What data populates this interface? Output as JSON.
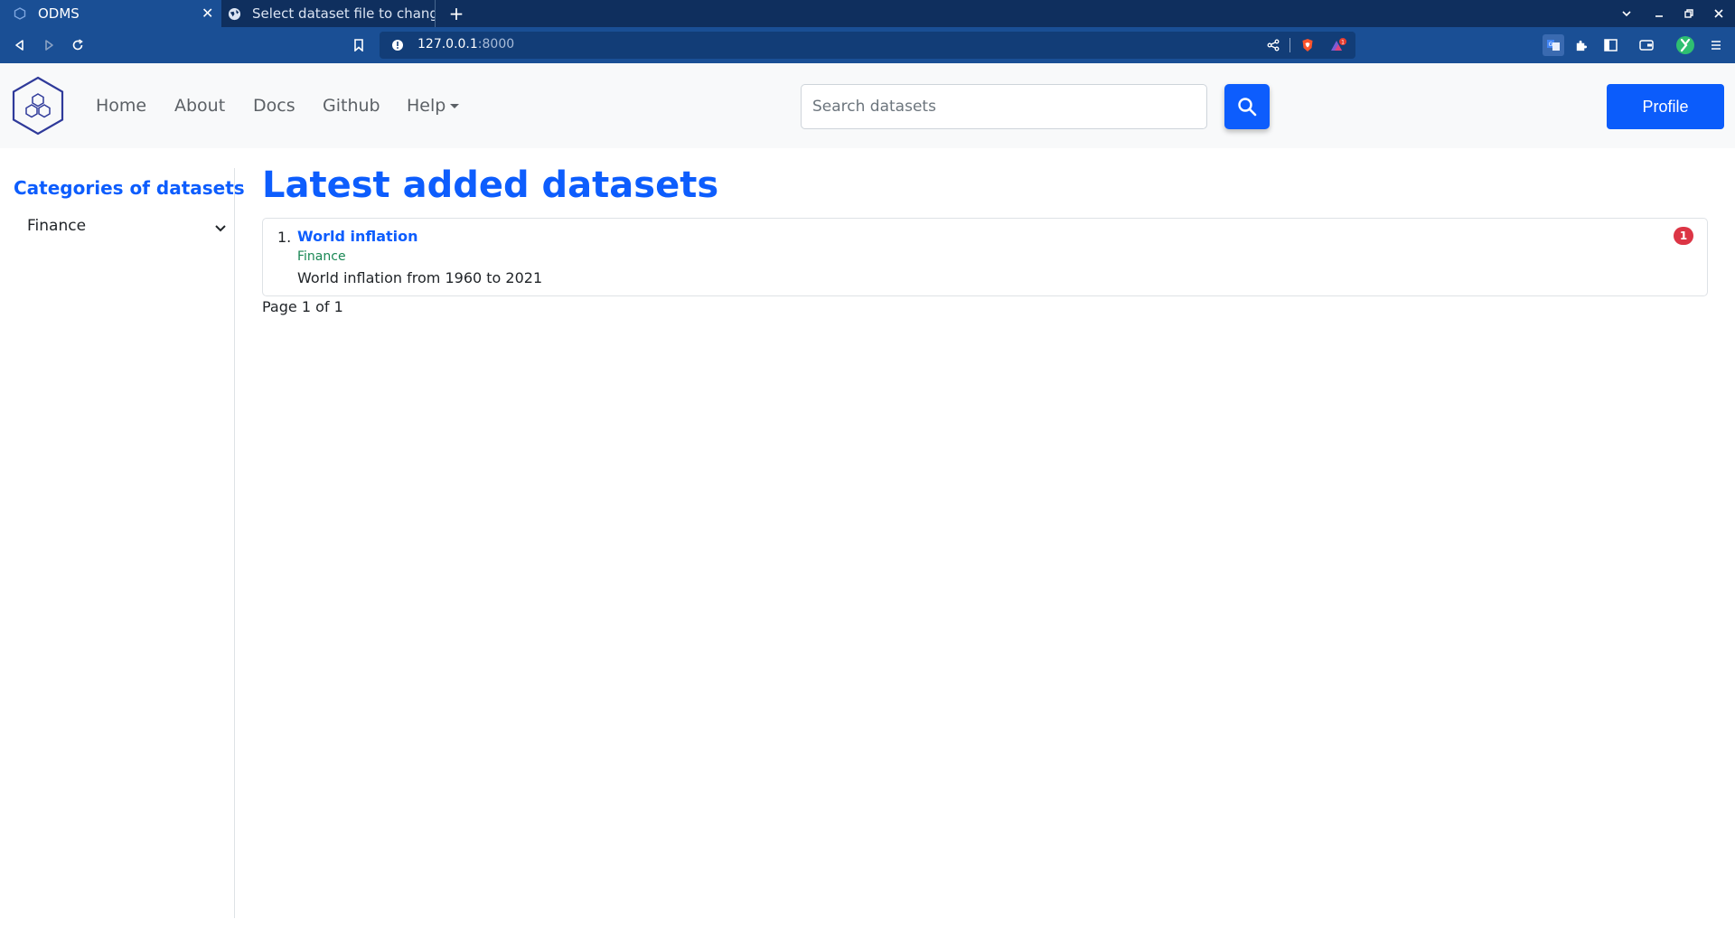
{
  "browser": {
    "tabs": [
      {
        "title": "ODMS",
        "active": true
      },
      {
        "title": "Select dataset file to change | D",
        "active": false
      }
    ],
    "url_host": "127.0.0.1",
    "url_port": ":8000"
  },
  "navbar": {
    "links": [
      "Home",
      "About",
      "Docs",
      "Github",
      "Help"
    ],
    "search_placeholder": "Search datasets",
    "profile_label": "Profile"
  },
  "sidebar": {
    "title": "Categories of datasets",
    "categories": [
      "Finance"
    ]
  },
  "main": {
    "title": "Latest added datasets",
    "datasets": [
      {
        "number": "1.",
        "title": "World inflation",
        "category": "Finance",
        "description": "World inflation from 1960 to 2021",
        "badge": "1"
      }
    ],
    "pagination": "Page 1 of 1"
  },
  "colors": {
    "brand": "#0d5dfd",
    "category": "#198754",
    "badge": "#dc3545",
    "tabstrip": "#0f2f5e",
    "toolbar": "#1a4f95"
  }
}
